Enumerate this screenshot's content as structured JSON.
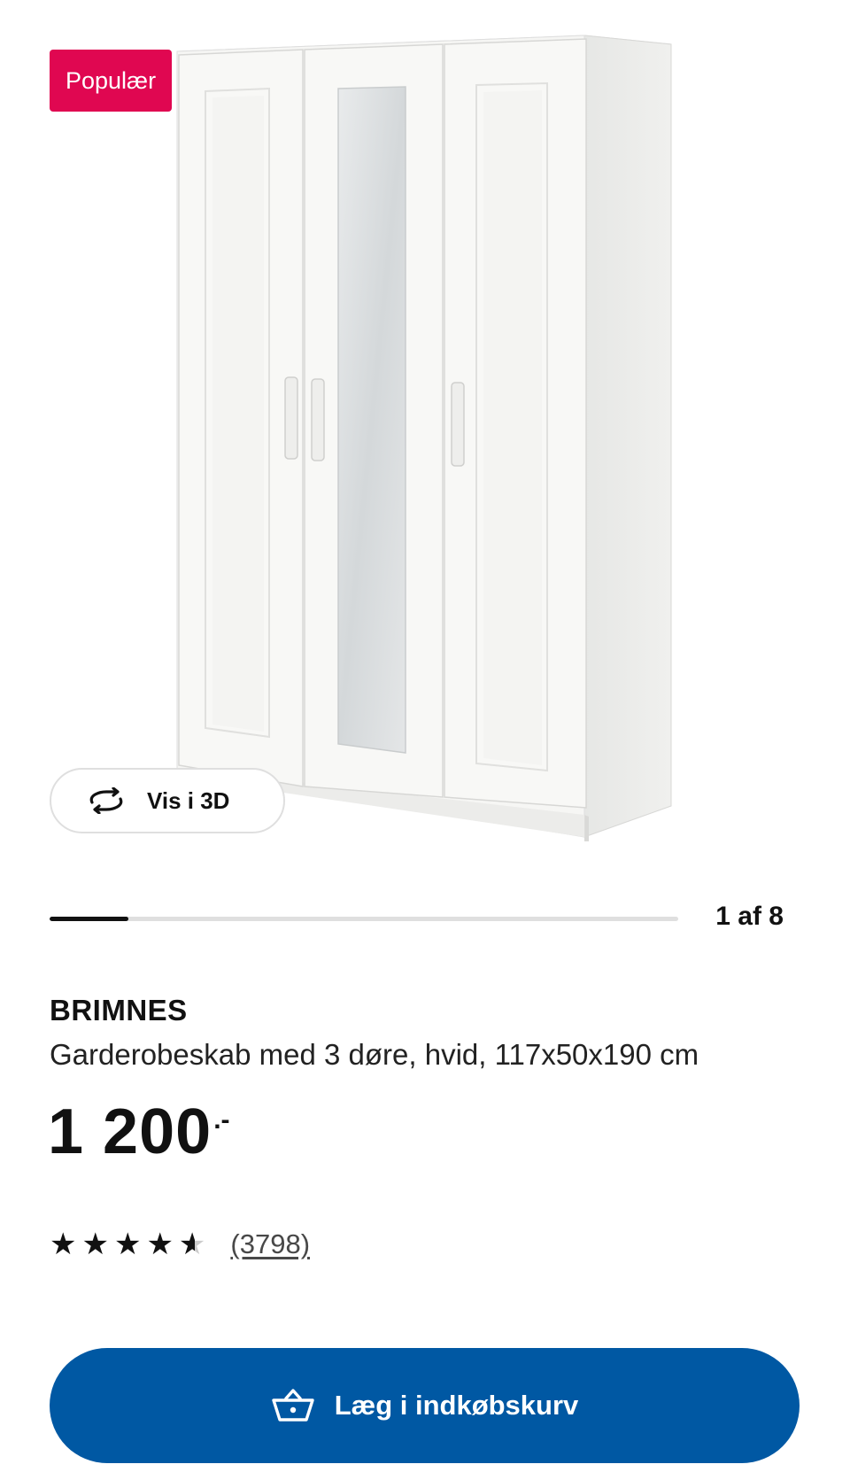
{
  "gallery": {
    "badge": "Populær",
    "view3d_label": "Vis i 3D",
    "view3d_icon": "rotate-3d-icon",
    "current_image": 1,
    "total_images": 8,
    "counter_text": "1 af 8",
    "progress_fraction": 0.125
  },
  "product": {
    "name": "BRIMNES",
    "description": "Garderobeskab med 3 døre, hvid, 117x50x190 cm",
    "price": "1 200",
    "price_suffix": ".-"
  },
  "rating": {
    "value": 4.5,
    "max": 5,
    "review_count_text": "(3798)"
  },
  "cart_button": {
    "label": "Læg i indkøbskurv",
    "icon": "shopping-basket-icon"
  },
  "colors": {
    "badge": "#e00751",
    "primary_button": "#0058a3",
    "text": "#111111"
  }
}
